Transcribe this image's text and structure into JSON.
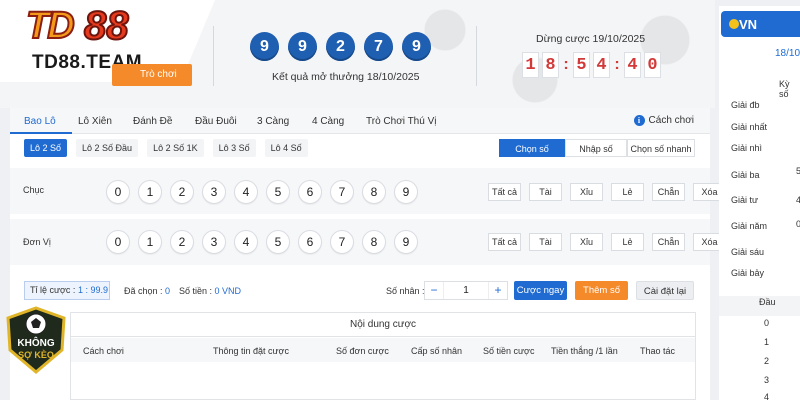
{
  "brand": {
    "name": "TD88",
    "site": "TD88.TEAM",
    "play_label": "Trò chơi"
  },
  "result": {
    "balls": [
      "9",
      "9",
      "2",
      "7",
      "9"
    ],
    "date_text": "Kết quả mở thưởng 18/10/2025"
  },
  "deadline": {
    "label": "Dừng cược 19/10/2025",
    "digits": [
      "1",
      "8",
      ":",
      "5",
      "4",
      ":",
      "4",
      "0"
    ]
  },
  "tabs": [
    "Bao Lô",
    "Lô Xiên",
    "Đánh Đề",
    "Đầu Đuôi",
    "3 Càng",
    "4 Càng",
    "Trò Chơi Thú Vị"
  ],
  "active_tab": "Bao Lô",
  "howto_label": "Cách chơi",
  "subtabs": [
    "Lô 2 Số",
    "Lô 2 Số Đầu",
    "Lô 2 Số 1K",
    "Lô 3 Số",
    "Lô 4 Số"
  ],
  "modes": [
    "Chọn số",
    "Nhập số",
    "Chọn số nhanh"
  ],
  "rows": [
    {
      "label": "Chục",
      "digits": [
        "0",
        "1",
        "2",
        "3",
        "4",
        "5",
        "6",
        "7",
        "8",
        "9"
      ]
    },
    {
      "label": "Đơn Vị",
      "digits": [
        "0",
        "1",
        "2",
        "3",
        "4",
        "5",
        "6",
        "7",
        "8",
        "9"
      ]
    }
  ],
  "quick_buttons": [
    "Tất cả",
    "Tài",
    "Xỉu",
    "Lẻ",
    "Chẵn",
    "Xóa"
  ],
  "betbar": {
    "rate_label": "Tỉ lệ cược : ",
    "rate_value": "1 : 99.9",
    "selected_label": "Đã chọn : ",
    "selected_value": "0",
    "amount_label": "Số tiền : ",
    "amount_value": "0 VND",
    "multiplier_label": "Số nhân :",
    "multiplier_value": "1",
    "bet_now": "Cược ngay",
    "add_number": "Thêm số",
    "reset": "Cài đặt lại"
  },
  "content": {
    "title": "Nội dung cược",
    "columns": [
      "Cách chơi",
      "Thông tin đặt cược",
      "Số đơn cược",
      "Cấp số nhân",
      "Số tiền cược",
      "Tiền thắng /1 lần",
      "Thao tác"
    ]
  },
  "right_panel": {
    "brand": "VN",
    "date": "18/10/",
    "kyso": "Kỳ số",
    "prizes": [
      {
        "name": "Giải đb",
        "value": ""
      },
      {
        "name": "Giải nhất",
        "value": ""
      },
      {
        "name": "Giải nhì",
        "value": ""
      },
      {
        "name": "Giải ba",
        "value": "5"
      },
      {
        "name": "Giải tư",
        "value": "4"
      },
      {
        "name": "Giải năm",
        "value": "0"
      },
      {
        "name": "Giải sáu",
        "value": ""
      },
      {
        "name": "Giải bảy",
        "value": ""
      }
    ],
    "dau_label": "Đầu",
    "dau_values": [
      "0",
      "1",
      "2",
      "3",
      "4"
    ]
  },
  "watermark": {
    "line1": "KHÔNG",
    "line2": "SỢ KÈO"
  },
  "colors": {
    "primary": "#1f6bd1",
    "accent": "#f58a2a",
    "countdown": "#d23a3a",
    "ball": "#1f5fb2"
  }
}
